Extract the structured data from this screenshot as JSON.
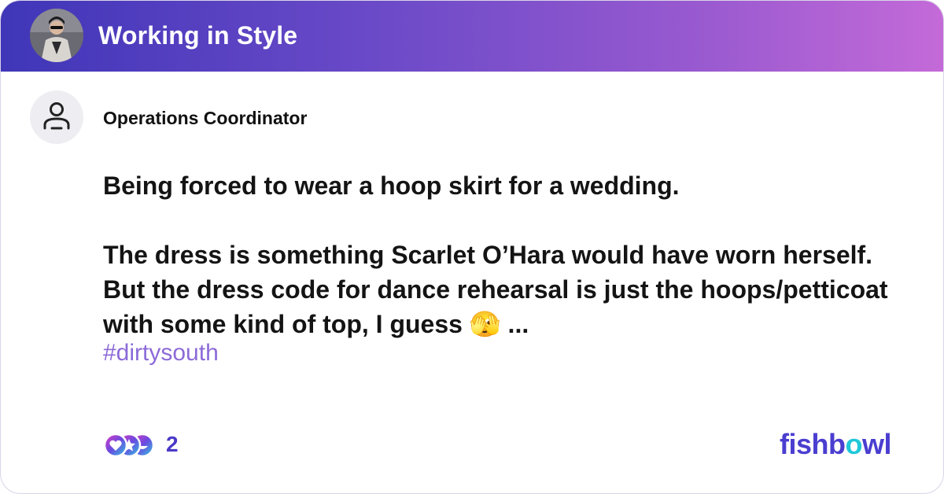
{
  "header": {
    "group_name": "Working in Style",
    "gradient": [
      "#3f36b8",
      "#c46ad8"
    ]
  },
  "post": {
    "author_role": "Operations Coordinator",
    "lines": [
      "Being forced to wear a hoop skirt for a wedding.",
      "",
      "The dress is something Scarlet O’Hara would have worn herself. But the dress code for dance rehearsal is just the hoops/petticoat with some kind of top, I guess 🫣 ..."
    ],
    "hashtag": "#dirtysouth"
  },
  "footer": {
    "reaction_icons": [
      "love-reaction-icon",
      "star-reaction-icon",
      "laugh-reaction-icon"
    ],
    "reaction_count": "2",
    "brand_parts": [
      "fishb",
      "o",
      "wl"
    ],
    "brand_colors": [
      "#4a3ed0",
      "#1fc8d8"
    ]
  }
}
